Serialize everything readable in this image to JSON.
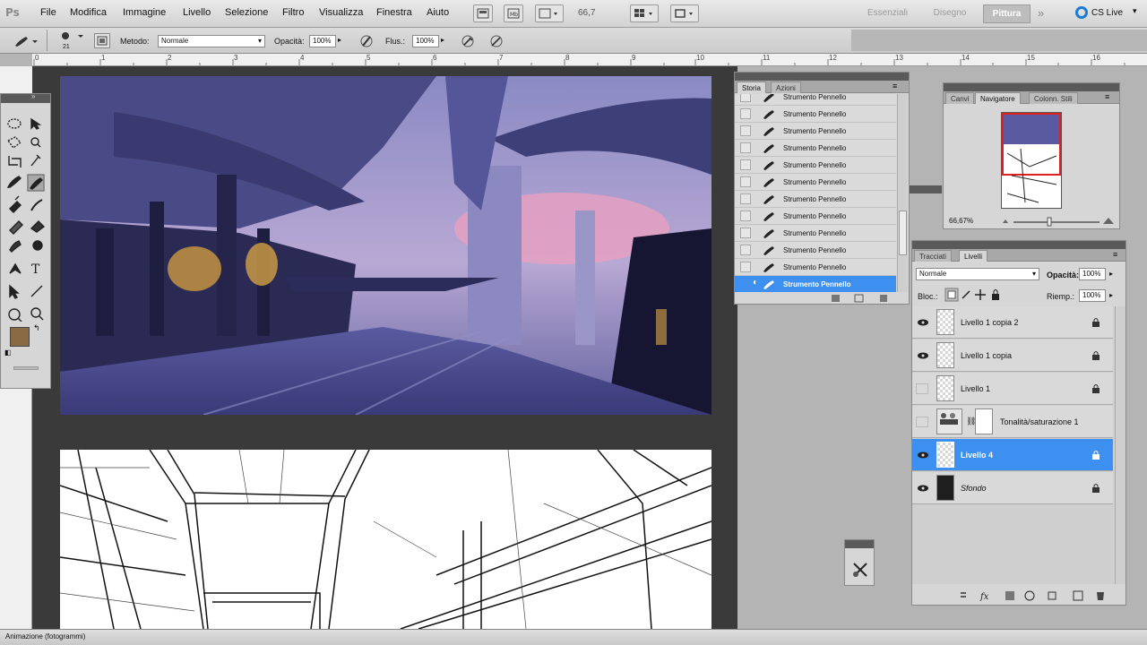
{
  "app": {
    "logo": "Ps"
  },
  "menu": [
    "File",
    "Modifica",
    "Immagine",
    "Livello",
    "Selezione",
    "Filtro",
    "Visualizza",
    "Finestra",
    "Aiuto"
  ],
  "zoom_field": "66,7",
  "workspaces": {
    "items": [
      "Essenziali",
      "Disegno",
      "Pittura"
    ],
    "active": "Pittura",
    "cs_live": "CS Live"
  },
  "options": {
    "brush_size": "21",
    "method_label": "Metodo:",
    "method_value": "Normale",
    "opacity_label": "Opacità:",
    "opacity_value": "100%",
    "flow_label": "Flus.:",
    "flow_value": "100%"
  },
  "ruler": {
    "numbers": [
      "0",
      "1",
      "2",
      "3",
      "4",
      "5",
      "6",
      "7",
      "8",
      "9",
      "10",
      "11",
      "12",
      "13",
      "14",
      "15",
      "16"
    ]
  },
  "history": {
    "tabs": [
      "Storia",
      "Azioni"
    ],
    "active_tab": "Storia",
    "items": [
      "Strumento Pennello",
      "Strumento Pennello",
      "Strumento Pennello",
      "Strumento Pennello",
      "Strumento Pennello",
      "Strumento Pennello",
      "Strumento Pennello",
      "Strumento Pennello",
      "Strumento Pennello",
      "Strumento Pennello",
      "Strumento Pennello"
    ],
    "selected": "Strumento Pennello"
  },
  "navigator": {
    "tabs": [
      "Canvi",
      "Navigatore",
      "Colonn. Stili"
    ],
    "active_tab": "Navigatore",
    "zoom": "66,67%"
  },
  "layers": {
    "tabs": [
      "Tracciati",
      "Livelli"
    ],
    "active_tab": "Livelli",
    "blend_mode": "Normale",
    "opacity_label": "Opacità:",
    "opacity_value": "100%",
    "lock_label": "Bloc.:",
    "fill_label": "Riemp.:",
    "fill_value": "100%",
    "items": [
      {
        "name": "Livello 1 copia 2",
        "visible": true,
        "selected": false
      },
      {
        "name": "Livello 1 copia",
        "visible": true,
        "selected": false
      },
      {
        "name": "Livello 1",
        "visible": false,
        "selected": false
      },
      {
        "name": "Tonalità/saturazione 1",
        "visible": false,
        "selected": false
      },
      {
        "name": "Livello 4",
        "visible": true,
        "selected": true
      },
      {
        "name": "Sfondo",
        "visible": true,
        "selected": false
      }
    ]
  },
  "status": {
    "animation_label": "Animazione (fotogrammi)"
  },
  "colors": {
    "foreground": "#8a6a45",
    "background": "#5a56a3",
    "selection": "#3d8ff0"
  }
}
